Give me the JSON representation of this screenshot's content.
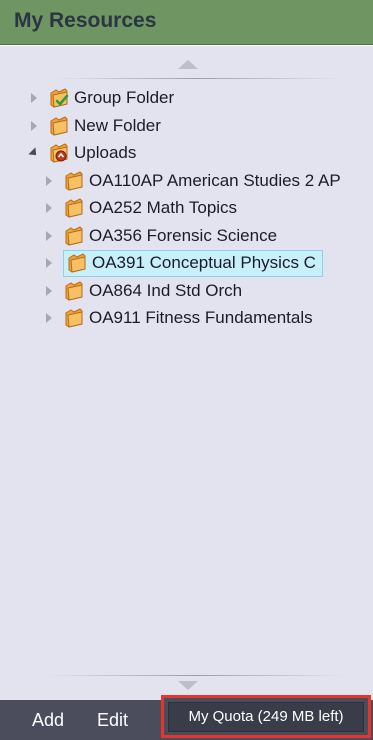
{
  "header": {
    "title": "My Resources"
  },
  "tree": {
    "nodes": [
      {
        "label": "Group Folder",
        "icon": "shared-folder-icon",
        "expanded": false
      },
      {
        "label": "New Folder",
        "icon": "folder-icon",
        "expanded": false
      },
      {
        "label": "Uploads",
        "icon": "uploads-folder-icon",
        "expanded": true
      },
      {
        "label": "OA110AP American Studies 2 AP",
        "icon": "folder-icon",
        "expanded": false
      },
      {
        "label": "OA252 Math Topics",
        "icon": "folder-icon",
        "expanded": false
      },
      {
        "label": "OA356 Forensic Science",
        "icon": "folder-icon",
        "expanded": false
      },
      {
        "label": "OA391 Conceptual Physics C",
        "icon": "folder-icon",
        "expanded": false,
        "selected": true
      },
      {
        "label": "OA864 Ind Std Orch",
        "icon": "folder-icon",
        "expanded": false
      },
      {
        "label": "OA911 Fitness Fundamentals",
        "icon": "folder-icon",
        "expanded": false
      }
    ]
  },
  "toolbar": {
    "add_label": "Add",
    "edit_label": "Edit",
    "quota_label": "My Quota (249 MB left)"
  },
  "colors": {
    "header_bg": "#6f9562",
    "tree_bg": "#e3e2ef",
    "toolbar_bg": "#4b4d5c",
    "selection_bg": "#c7f0fb",
    "highlight_border": "#e8352b"
  }
}
